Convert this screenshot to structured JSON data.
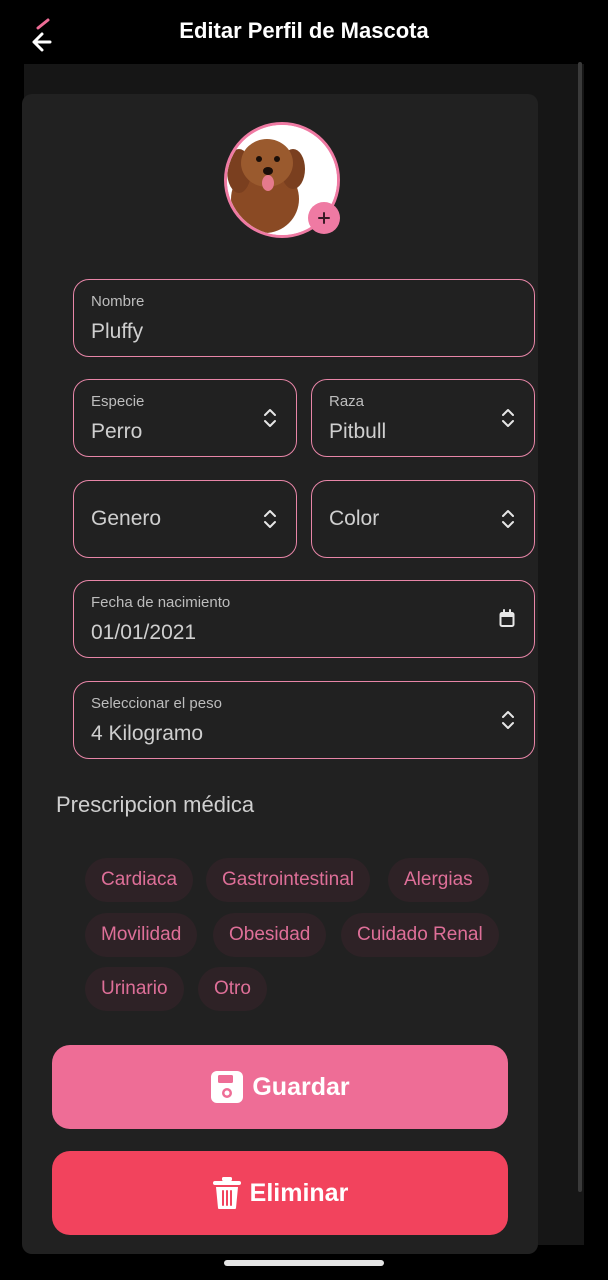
{
  "header": {
    "title": "Editar Perfil de Mascota"
  },
  "colors": {
    "accent": "#ee6d96",
    "danger": "#f2435d",
    "card": "#212121"
  },
  "form": {
    "name": {
      "label": "Nombre",
      "value": "Pluffy"
    },
    "species": {
      "label": "Especie",
      "value": "Perro"
    },
    "breed": {
      "label": "Raza",
      "value": "Pitbull"
    },
    "gender": {
      "placeholder": "Genero"
    },
    "color": {
      "placeholder": "Color"
    },
    "birthdate": {
      "label": "Fecha de nacimiento",
      "value": "01/01/2021"
    },
    "weight": {
      "label": "Seleccionar el peso",
      "value": "4 Kilogramo"
    }
  },
  "prescription": {
    "title": "Prescripcion médica",
    "chips": [
      "Cardiaca",
      "Gastrointestinal",
      "Alergias",
      "Movilidad",
      "Obesidad",
      "Cuidado Renal",
      "Urinario",
      "Otro"
    ]
  },
  "actions": {
    "save_label": "Guardar",
    "delete_label": "Eliminar"
  },
  "icons": {
    "back": "back-arrow-icon",
    "avatar_add": "plus-icon",
    "select": "chevron-up-down-icon",
    "calendar": "calendar-icon",
    "save": "floppy-disk-icon",
    "delete": "trash-icon"
  }
}
